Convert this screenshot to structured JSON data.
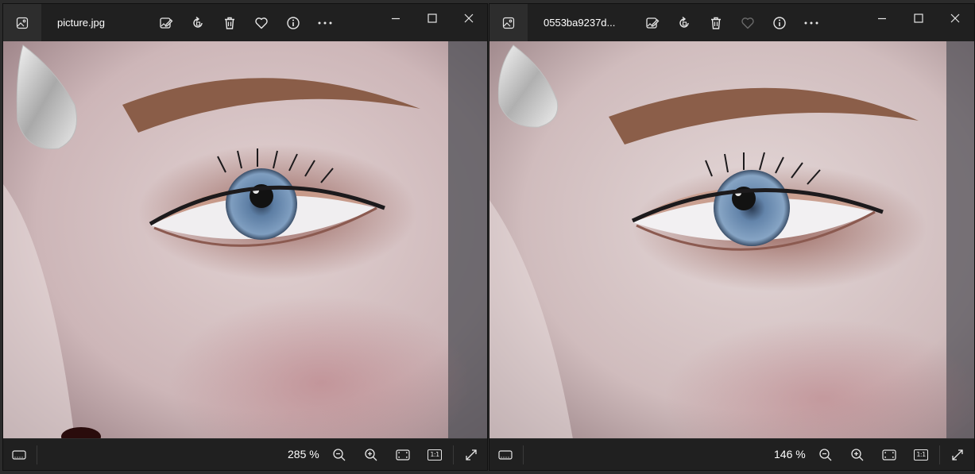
{
  "windows": [
    {
      "id": "left",
      "file_name": "picture.jpg",
      "toolbar_icons": [
        "edit-image-icon",
        "rotate-icon",
        "delete-icon",
        "favorite-icon",
        "info-icon",
        "more-icon"
      ],
      "zoom_label": "285 %",
      "ratio_label": "1:1",
      "favorite_dimmed": false
    },
    {
      "id": "right",
      "file_name": "0553ba9237d...",
      "toolbar_icons": [
        "edit-image-icon",
        "rotate-icon",
        "delete-icon",
        "favorite-icon",
        "info-icon",
        "more-icon"
      ],
      "zoom_label": "146 %",
      "ratio_label": "1:1",
      "favorite_dimmed": true
    }
  ],
  "colors": {
    "chrome_bg": "#202020",
    "icon_color": "#e6e6e6",
    "dimmed_icon": "#6a6a6a",
    "skin": "#d9c8c8",
    "iris": "#5f7fa3",
    "eyeshadow": "#a86b5c",
    "brow": "#8a5d48"
  }
}
